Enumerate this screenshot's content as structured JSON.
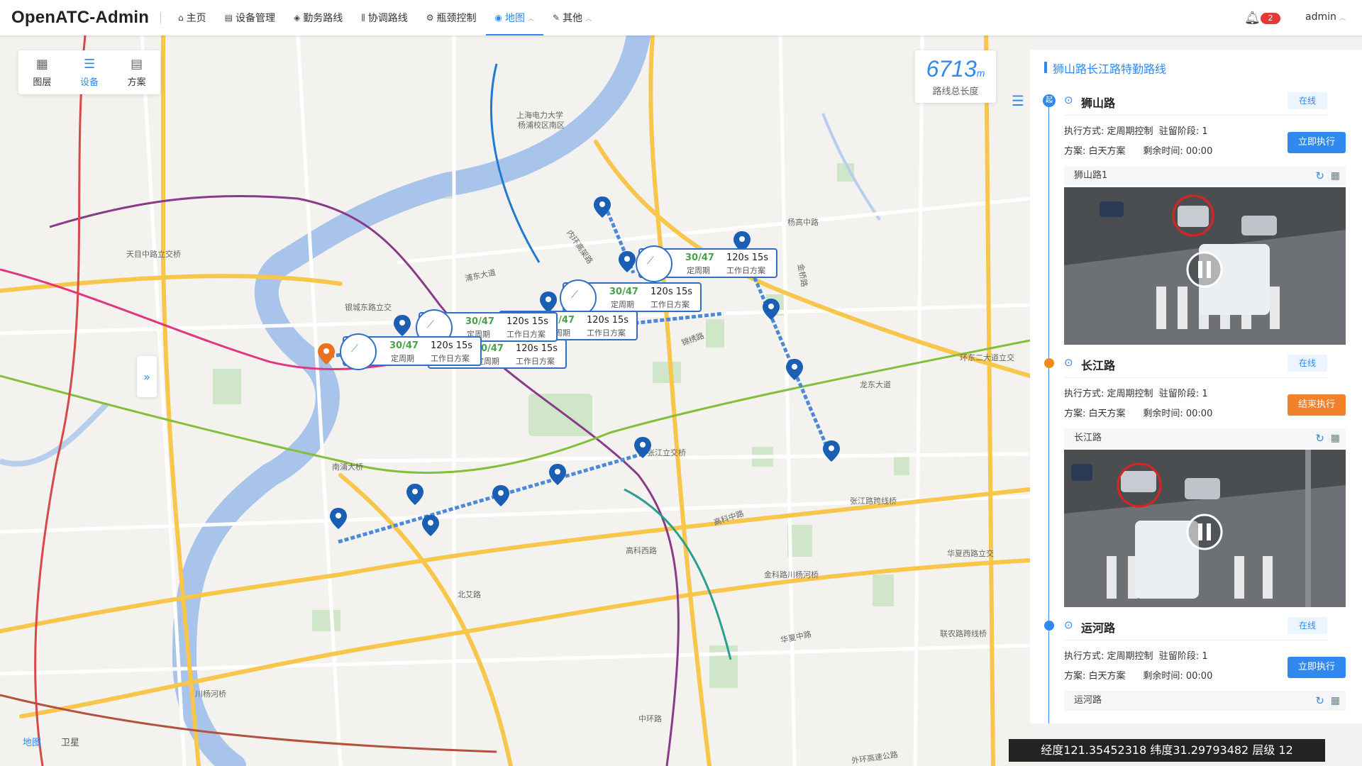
{
  "app": {
    "title": "OpenATC-Admin",
    "user": "admin",
    "notifications": "2"
  },
  "nav": [
    {
      "label": "主页",
      "icon": "home-icon",
      "glyph": "⌂"
    },
    {
      "label": "设备管理",
      "icon": "device-icon",
      "glyph": "▤"
    },
    {
      "label": "勤务路线",
      "icon": "shield-icon",
      "glyph": "◈"
    },
    {
      "label": "协调路线",
      "icon": "bars-icon",
      "glyph": "⫼"
    },
    {
      "label": "瓶颈控制",
      "icon": "bottleneck-icon",
      "glyph": "⚙"
    },
    {
      "label": "地图",
      "icon": "map-pin-icon",
      "glyph": "◉"
    },
    {
      "label": "其他",
      "icon": "pen-icon",
      "glyph": "✎"
    }
  ],
  "map": {
    "tools": [
      {
        "label": "图层",
        "glyph": "▦"
      },
      {
        "label": "设备",
        "glyph": "☰"
      },
      {
        "label": "方案",
        "glyph": "▤"
      }
    ],
    "route_length": {
      "value": "6713",
      "unit": "m",
      "label": "路线总长度"
    },
    "layers": {
      "map": "地图",
      "satellite": "卫星"
    },
    "coordinates": "经度121.35452318 纬度31.29793482 层级 12",
    "popup": {
      "ratio": "30/47",
      "cycle": "120s",
      "time": "15s",
      "mode": "定周期",
      "plan": "工作日方案"
    },
    "place_labels": [
      "上海电力大学",
      "杨浦校区南区",
      "天目中路立交桥",
      "浦东大道",
      "银城东路立交",
      "南浦大桥",
      "张江立交桥",
      "张江路跨线桥",
      "华夏西路立交",
      "锦绣路",
      "中环路",
      "高科中路",
      "高科西路",
      "北艾路",
      "金科路川杨河桥",
      "外环高速公路",
      "龙东大道",
      "环东二大道立交",
      "内环高架路",
      "杨高中路",
      "联农路跨线桥",
      "川杨河桥",
      "华夏中路",
      "金桥路"
    ]
  },
  "panel": {
    "title": "狮山路长江路特勤路线",
    "routes": [
      {
        "marker": "起",
        "name": "狮山路",
        "status": "在线",
        "mode_label": "执行方式:",
        "mode": "定周期控制",
        "stage_label": "驻留阶段:",
        "stage": "1",
        "plan_label": "方案:",
        "plan": "白天方案",
        "remain_label": "剩余时间:",
        "remain": "00:00",
        "button": "立即执行",
        "camera": "狮山路1"
      },
      {
        "name": "长江路",
        "status": "在线",
        "mode_label": "执行方式:",
        "mode": "定周期控制",
        "stage_label": "驻留阶段:",
        "stage": "1",
        "plan_label": "方案:",
        "plan": "白天方案",
        "remain_label": "剩余时间:",
        "remain": "00:00",
        "button": "结束执行",
        "camera": "长江路"
      },
      {
        "name": "运河路",
        "status": "在线",
        "mode_label": "执行方式:",
        "mode": "定周期控制",
        "stage_label": "驻留阶段:",
        "stage": "1",
        "plan_label": "方案:",
        "plan": "白天方案",
        "remain_label": "剩余时间:",
        "remain": "00:00",
        "button": "立即执行",
        "camera": "运河路"
      }
    ]
  },
  "colors": {
    "accent": "#2f89ef",
    "warning": "#f0812a",
    "river": "#a8c4ea",
    "park": "#cfe6c8",
    "highway": "#f7c64a"
  }
}
